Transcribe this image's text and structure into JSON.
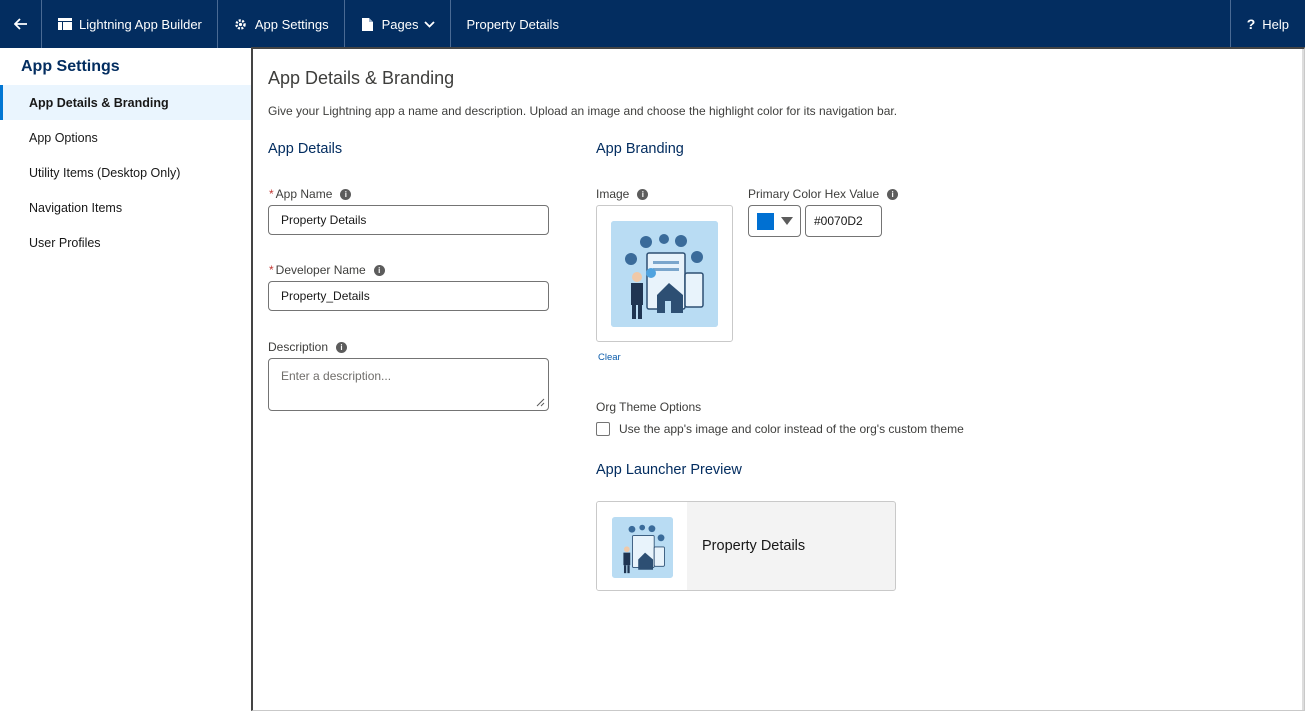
{
  "topbar": {
    "back_icon": "arrow-left-icon",
    "app_builder_label": "Lightning App Builder",
    "app_settings_label": "App Settings",
    "pages_label": "Pages",
    "current_app": "Property Details",
    "help_label": "Help",
    "background_color": "#032d60"
  },
  "sidebar": {
    "title": "App Settings",
    "items": [
      {
        "label": "App Details & Branding",
        "active": true
      },
      {
        "label": "App Options",
        "active": false
      },
      {
        "label": "Utility Items (Desktop Only)",
        "active": false
      },
      {
        "label": "Navigation Items",
        "active": false
      },
      {
        "label": "User Profiles",
        "active": false
      }
    ]
  },
  "main": {
    "title": "App Details & Branding",
    "description": "Give your Lightning app a name and description. Upload an image and choose the highlight color for its navigation bar.",
    "app_details": {
      "heading": "App Details",
      "app_name": {
        "label": "App Name",
        "required_mark": "*",
        "value": "Property Details"
      },
      "developer_name": {
        "label": "Developer Name",
        "required_mark": "*",
        "value": "Property_Details"
      },
      "description": {
        "label": "Description",
        "placeholder": "Enter a description..."
      }
    },
    "app_branding": {
      "heading": "App Branding",
      "image_label": "Image",
      "clear_label": "Clear",
      "primary_color_label": "Primary Color Hex Value",
      "primary_color_value": "#0070D2",
      "org_theme_label": "Org Theme Options",
      "org_theme_checkbox_label": "Use the app's image and color instead of the org's custom theme",
      "org_theme_checked": false
    },
    "launcher_preview": {
      "heading": "App Launcher Preview",
      "app_name": "Property Details"
    }
  }
}
